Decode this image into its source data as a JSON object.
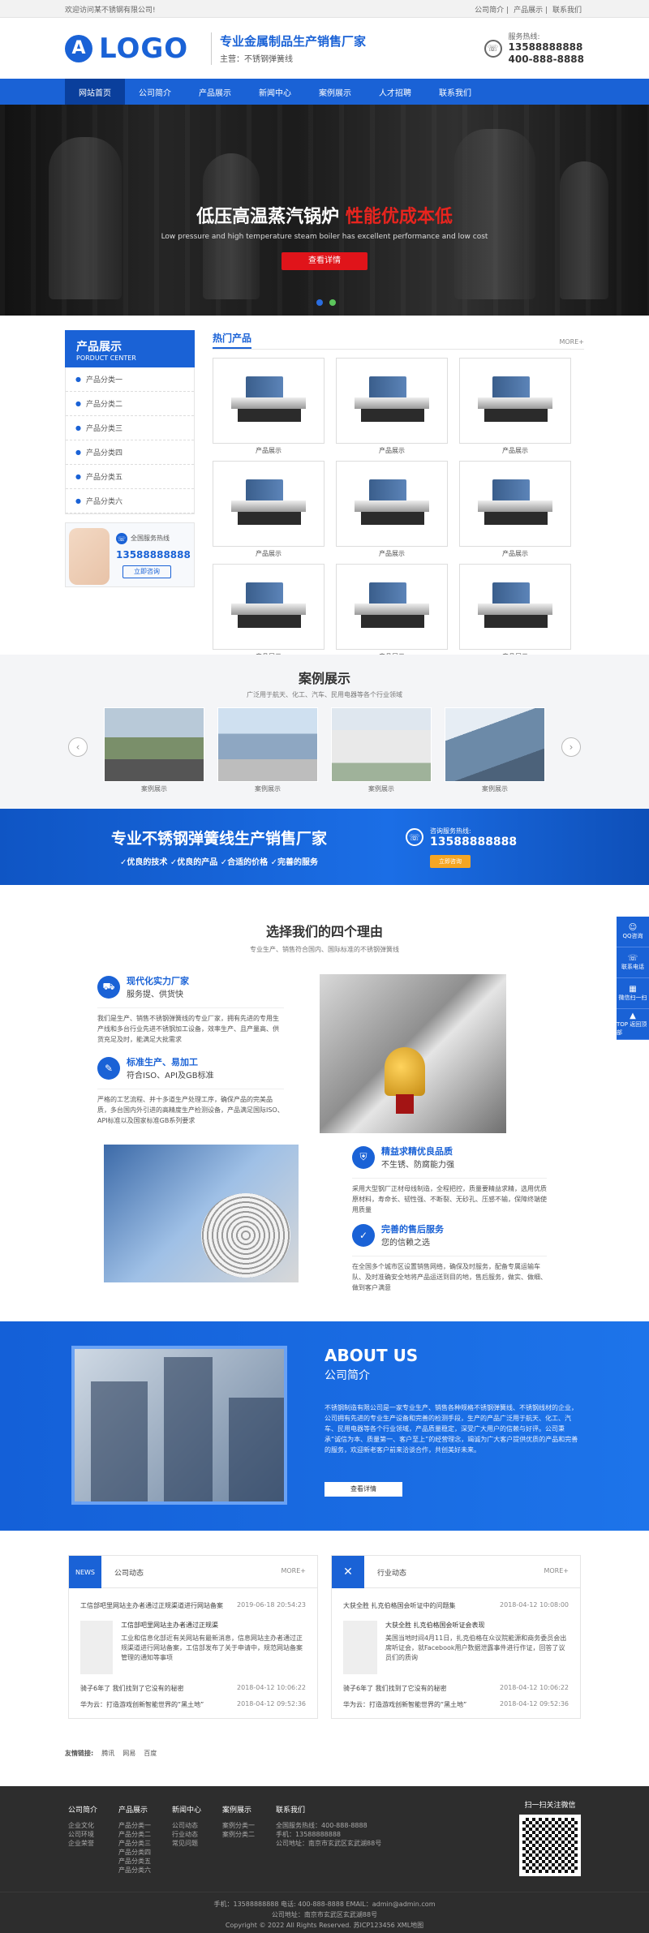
{
  "topbar": {
    "welcome": "欢迎访问某不锈钢有限公司!",
    "links": [
      "公司简介",
      "产品展示",
      "联系我们"
    ]
  },
  "header": {
    "logo_letter": "A",
    "logo_text": "LOGO",
    "slogan_title": "专业金属制品生产销售厂家",
    "slogan_sub": "主营：不锈钢弹簧线",
    "hotline_label": "服务热线:",
    "hotline_1": "13588888888",
    "hotline_2": "400-888-8888"
  },
  "nav": {
    "items": [
      "网站首页",
      "公司简介",
      "产品展示",
      "新闻中心",
      "案例展示",
      "人才招聘",
      "联系我们"
    ],
    "active_index": 0
  },
  "banner": {
    "title_main": "低压高温蒸汽锅炉",
    "title_red": "性能优成本低",
    "subtitle": "Low pressure and high temperature steam boiler has excellent performance and low cost",
    "button": "查看详情",
    "dot_colors": [
      "#2a6de0",
      "#5cc55c"
    ]
  },
  "sidebar": {
    "title": "产品展示",
    "title_en": "PORDUCT CENTER",
    "items": [
      "产品分类一",
      "产品分类二",
      "产品分类三",
      "产品分类四",
      "产品分类五",
      "产品分类六"
    ],
    "contact_label": "全国服务热线",
    "contact_number": "13588888888",
    "contact_button": "立即咨询"
  },
  "products": {
    "title": "热门产品",
    "more": "MORE+",
    "items": [
      "产品展示",
      "产品展示",
      "产品展示",
      "产品展示",
      "产品展示",
      "产品展示",
      "产品展示",
      "产品展示",
      "产品展示"
    ]
  },
  "cases": {
    "title": "案例展示",
    "subtitle": "广泛用于航天、化工、汽车、民用电器等各个行业领域",
    "items": [
      "案例展示",
      "案例展示",
      "案例展示",
      "案例展示"
    ]
  },
  "promo": {
    "title": "专业不锈钢弹簧线生产销售厂家",
    "features": "✓优良的技术  ✓优良的产品  ✓合适的价格  ✓完善的服务",
    "hotline_label": "咨询服务热线:",
    "hotline": "13588888888",
    "button": "立即咨询"
  },
  "reasons": {
    "title": "选择我们的四个理由",
    "subtitle": "专业生产、销售符合国内、国际标准的不锈钢弹簧线",
    "r1": {
      "title": "现代化实力厂家",
      "sub": "服务提、供货快",
      "text": "我们是生产、销售不锈钢弹簧线的专业厂家，拥有先进的专用生产线和多台行业先进不锈钢加工设备，效率生产、且产量高、供货充足及时，能满足大批需求"
    },
    "r2": {
      "title": "标准生产、易加工",
      "sub": "符合ISO、API及GB标准",
      "text": "严格的工艺流程、并十多道生产处理工序，确保产品的完美品质，多台国内外引进的高精度生产检测设备，产品满足国际ISO、API标准以及国家标准GB系列要求"
    },
    "r3": {
      "title": "精益求精优良品质",
      "sub": "不生锈、防腐能力强",
      "text": "采用大型钢厂正材母线制造，全程把控，质量要精益求精，选用优质原材料，寿命长、韧性强、不断裂、无砂孔、压感不输，保障终端使用质量"
    },
    "r4": {
      "title": "完善的售后服务",
      "sub": "您的信赖之选",
      "text": "在全国多个城市区设置销售网络，确保及时服务，配备专属运输车队、及时准确安全地将产品运送到目的地，售后服务，做实、做细、做到客户满意"
    }
  },
  "about": {
    "title_en": "ABOUT US",
    "title_cn": "公司简介",
    "text": "不锈钢制造有限公司是一家专业生产、销售各种规格不锈钢弹簧线、不锈钢线材的企业，公司拥有先进的专业生产设备和完善的检测手段，生产的产品广泛用于航天、化工、汽车、民用电器等各个行业领域，产品质量稳定，深受广大用户的信赖与好评。公司秉承“诚信为本、质量第一、客户至上”的经营理念，竭诚为广大客户提供优质的产品和完善的服务，欢迎新老客户前来洽谈合作，共创美好未来。",
    "button": "查看详情"
  },
  "news": {
    "left": {
      "label": "NEWS",
      "title": "公司动态",
      "more": "MORE+",
      "top": {
        "text": "工信部吧里网站主办者通过正规渠道进行网站备案",
        "date": "2019-06-18 20:54:23"
      },
      "feature_title": "工信部吧里网站主办者通过正规渠",
      "feature_text": "工业和信息化部近有关网站有最新消息，信息网站主办者通过正规渠道进行网站备案，工信部发布了关于申请中，规范网站备案管理的通知等事项",
      "rows": [
        {
          "text": "骑子6年了 我们找到了它没有的秘密",
          "date": "2018-04-12 10:06:22"
        },
        {
          "text": "华为云：打造游戏创新智能世界的“黑土地”",
          "date": "2018-04-12 09:52:36"
        }
      ]
    },
    "right": {
      "title": "行业动态",
      "more": "MORE+",
      "top": {
        "text": "大获全胜 扎克伯格国会听证中的问题集",
        "date": "2018-04-12 10:08:00"
      },
      "feature_title": "大获全胜 扎克伯格国会听证会表现",
      "feature_text": "美国当地时间4月11日，扎克伯格在众议院能源和商务委员会出席听证会，就Facebook用户数据泄露事件进行作证，回答了议员们的质询",
      "rows": [
        {
          "text": "骑子6年了 我们找到了它没有的秘密",
          "date": "2018-04-12 10:06:22"
        },
        {
          "text": "华为云：打造游戏创新智能世界的“黑土地”",
          "date": "2018-04-12 09:52:36"
        }
      ]
    }
  },
  "friend_links": {
    "label": "友情链接:",
    "items": [
      "腾讯",
      "网易",
      "百度"
    ]
  },
  "footer": {
    "cols": [
      {
        "title": "公司简介",
        "items": [
          "企业文化",
          "公司环境",
          "企业荣誉"
        ]
      },
      {
        "title": "产品展示",
        "items": [
          "产品分类一",
          "产品分类二",
          "产品分类三",
          "产品分类四",
          "产品分类五",
          "产品分类六"
        ]
      },
      {
        "title": "新闻中心",
        "items": [
          "公司动态",
          "行业动态",
          "常见问题"
        ]
      },
      {
        "title": "案例展示",
        "items": [
          "案例分类一",
          "案例分类二"
        ]
      },
      {
        "title": "联系我们",
        "items": [
          "全国服务热线：400-888-8888",
          "手机：13588888888",
          "公司地址：南京市玄武区玄武湖88号"
        ]
      }
    ],
    "qr_title": "扫一扫关注微信",
    "line1": "手机：13588888888 电话: 400-888-8888 EMAIL：admin@admin.com",
    "line2": "公司地址：南京市玄武区玄武湖88号",
    "line3": "Copyright © 2022 All Rights Reserved. 苏ICP123456 XML地图"
  },
  "float_bar": [
    "QQ咨询",
    "联系电话",
    "微信扫一扫",
    "TOP 返回顶部"
  ]
}
